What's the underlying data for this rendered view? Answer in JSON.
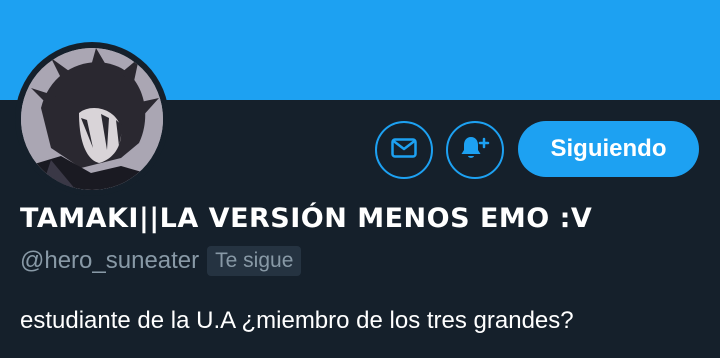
{
  "colors": {
    "banner": "#1da1f2",
    "background": "#15202b",
    "accent": "#1da1f2",
    "secondary_text": "#8899a6",
    "badge_bg": "#253341"
  },
  "actions": {
    "message_icon": "envelope-icon",
    "notifications_icon": "bell-plus-icon",
    "follow_label": "Siguiendo"
  },
  "profile": {
    "display_name": "TAMAKI||LA VERSIÓN MENOS EMO :V",
    "handle": "@hero_suneater",
    "follows_you": "Te sigue",
    "bio": "estudiante de la U.A ¿miembro de los tres grandes?"
  }
}
